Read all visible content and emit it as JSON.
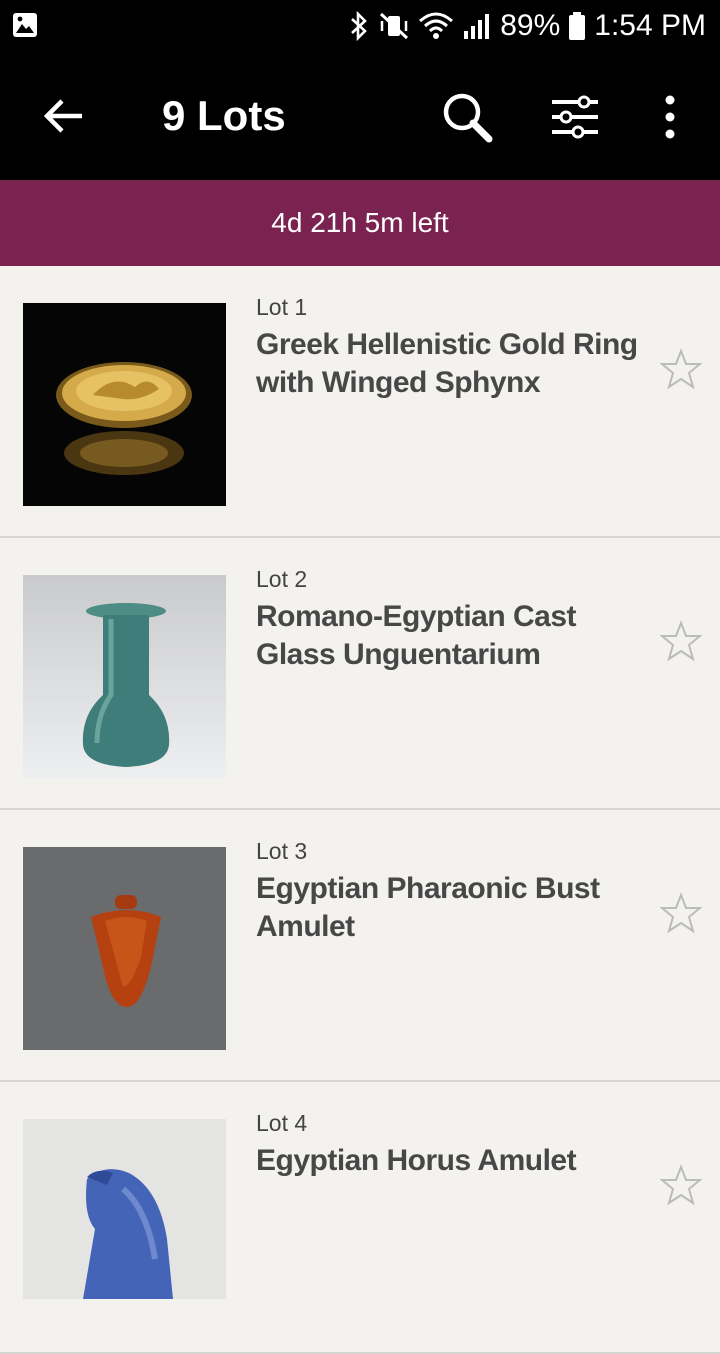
{
  "status_bar": {
    "battery": "89%",
    "time": "1:54 PM"
  },
  "app_bar": {
    "title": "9 Lots"
  },
  "banner": {
    "time_left": "4d 21h 5m left"
  },
  "lots": [
    {
      "lot": "Lot 1",
      "title": "Greek Hellenistic Gold Ring with Winged Sphynx"
    },
    {
      "lot": "Lot 2",
      "title": "Romano-Egyptian Cast Glass Unguentarium"
    },
    {
      "lot": "Lot 3",
      "title": "Egyptian Pharaonic Bust Amulet"
    },
    {
      "lot": "Lot 4",
      "title": "Egyptian Horus Amulet"
    }
  ],
  "colors": {
    "banner": "#7a2350",
    "app_bar": "#000000",
    "background": "#f3f2ef"
  }
}
